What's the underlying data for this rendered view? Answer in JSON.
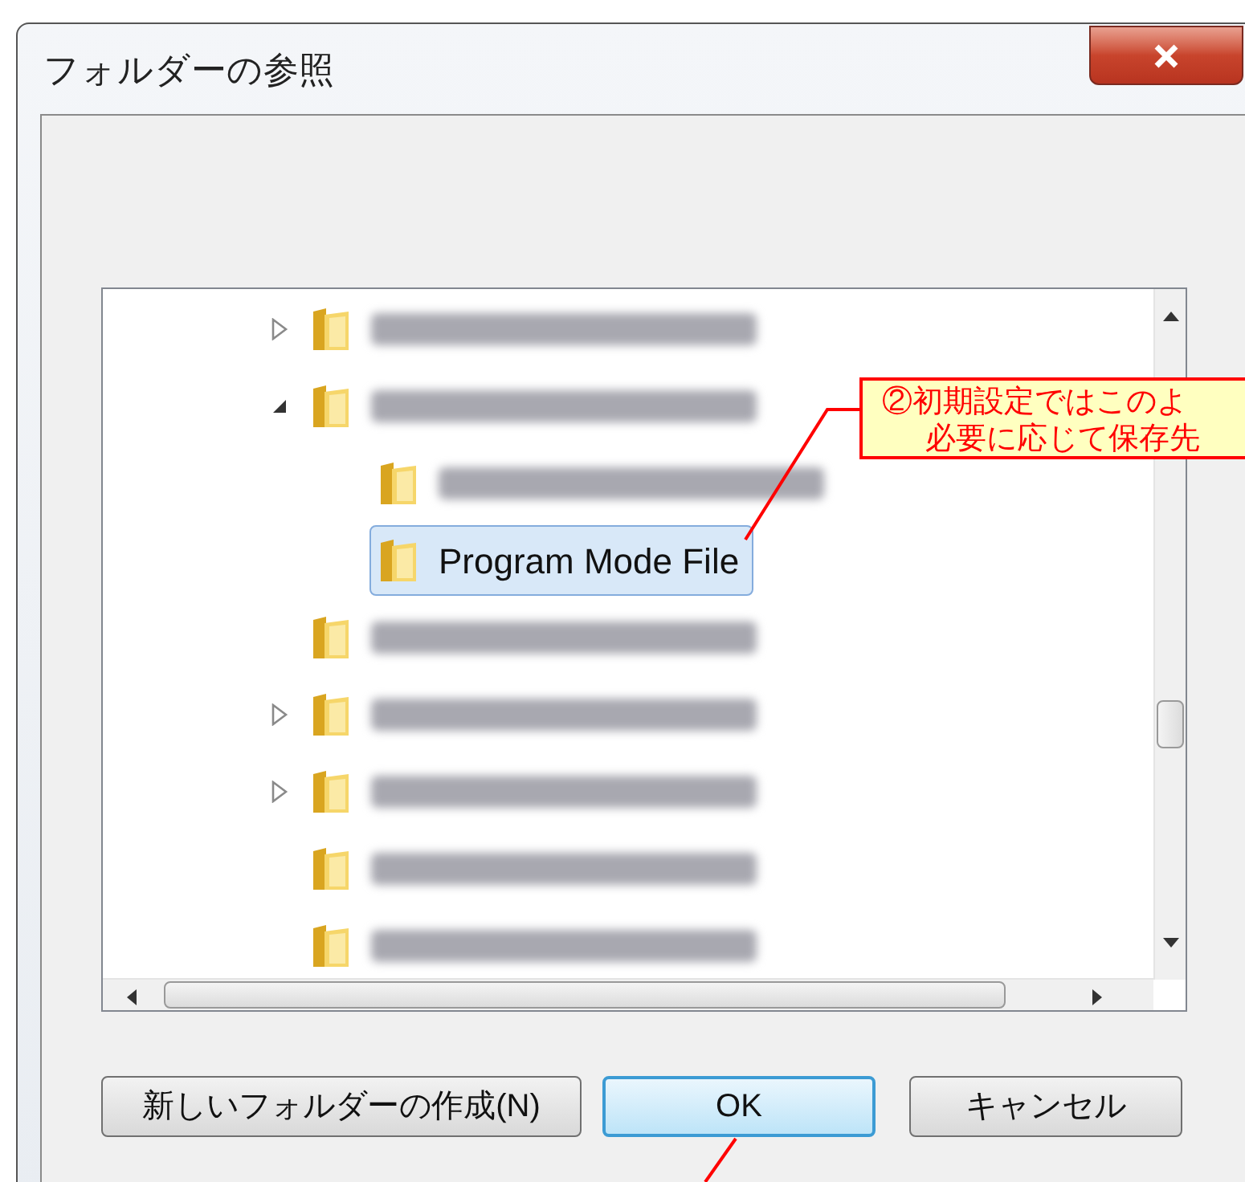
{
  "window": {
    "title": "フォルダーの参照"
  },
  "tree": {
    "items": [
      {
        "kind": "group",
        "children": [
          {
            "blurred": true,
            "expanded": false,
            "selected": false
          },
          {
            "blurred": true,
            "expanded": true,
            "selected": false,
            "children": [
              {
                "blurred": true,
                "selected": false
              },
              {
                "blurred": false,
                "label": "Program Mode File",
                "selected": true
              }
            ]
          },
          {
            "blurred": true,
            "selected": false
          },
          {
            "blurred": true,
            "expanded": false,
            "selected": false
          },
          {
            "blurred": true,
            "expanded": false,
            "selected": false
          },
          {
            "blurred": true,
            "selected": false
          }
        ]
      },
      {
        "blurred": true,
        "selected": false
      }
    ]
  },
  "callout": {
    "lines": [
      "②初期設定ではこのよ",
      "必要に応じて保存先"
    ]
  },
  "buttons": [
    {
      "label": "新しいフォルダーの作成(N)",
      "focused": false
    },
    {
      "label": "OK",
      "focused": true
    },
    {
      "label": "キャンセル",
      "focused": false
    }
  ]
}
